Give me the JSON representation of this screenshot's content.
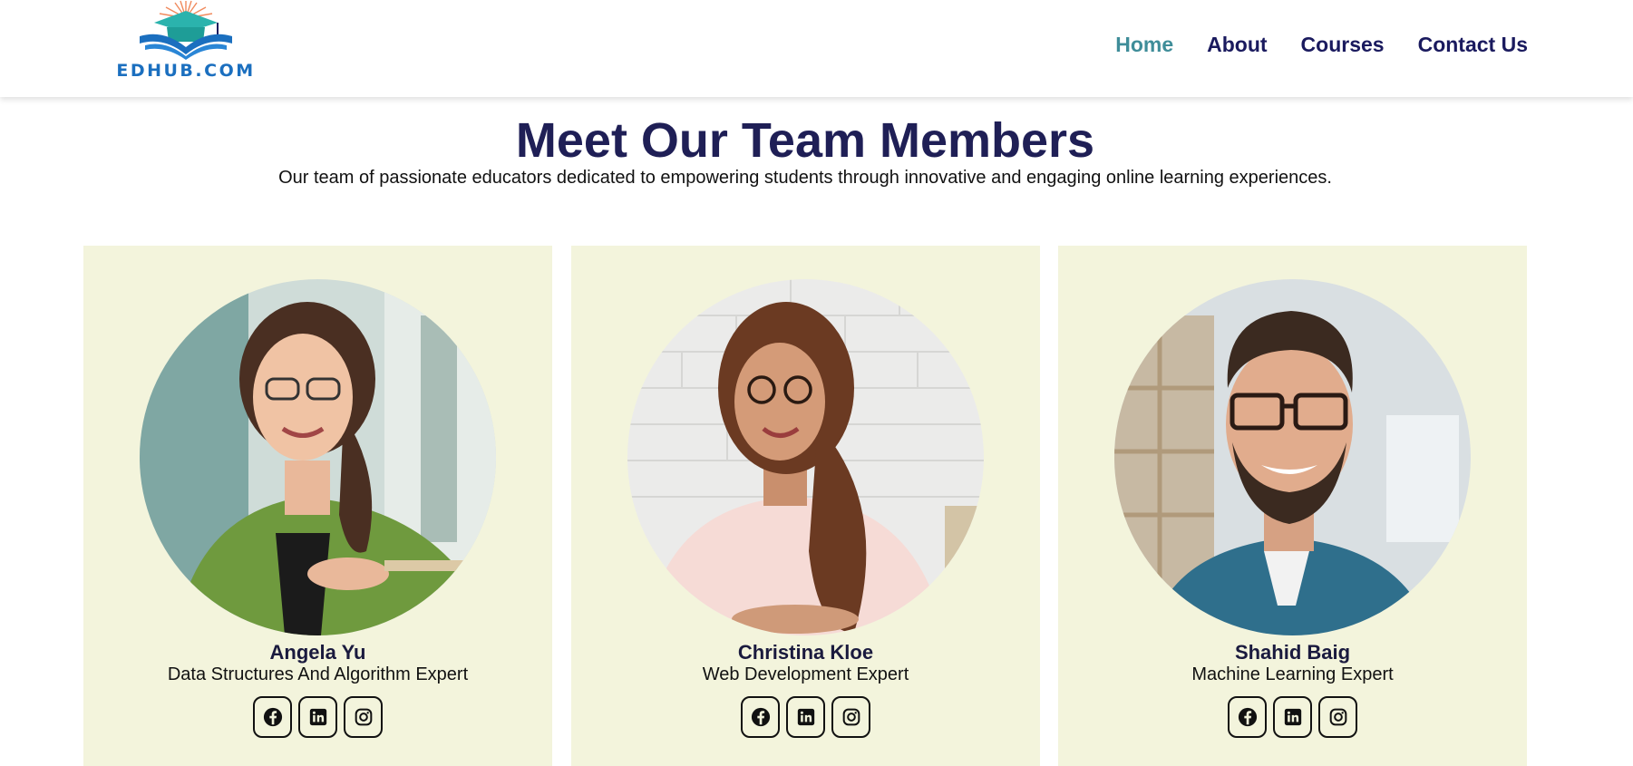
{
  "logo": {
    "text": "EDHUB.COM"
  },
  "nav": {
    "items": [
      "Home",
      "About",
      "Courses",
      "Contact Us"
    ],
    "active": "Home"
  },
  "colors": {
    "nav_text": "#1a1a5e",
    "nav_active": "#3f8d99",
    "heading": "#1f1f56",
    "card_bg": "#f3f4dc"
  },
  "team": {
    "title": "Meet Our Team Members",
    "subtitle": "Our team of passionate educators dedicated to empowering students through innovative and engaging online learning experiences.",
    "members": [
      {
        "name": "Angela Yu",
        "role": "Data Structures And Algorithm Expert",
        "socials": [
          "facebook-icon",
          "linkedin-icon",
          "instagram-icon"
        ]
      },
      {
        "name": "Christina Kloe",
        "role": "Web Development Expert",
        "socials": [
          "facebook-icon",
          "linkedin-icon",
          "instagram-icon"
        ]
      },
      {
        "name": "Shahid Baig",
        "role": "Machine Learning Expert",
        "socials": [
          "facebook-icon",
          "linkedin-icon",
          "instagram-icon"
        ]
      }
    ]
  }
}
